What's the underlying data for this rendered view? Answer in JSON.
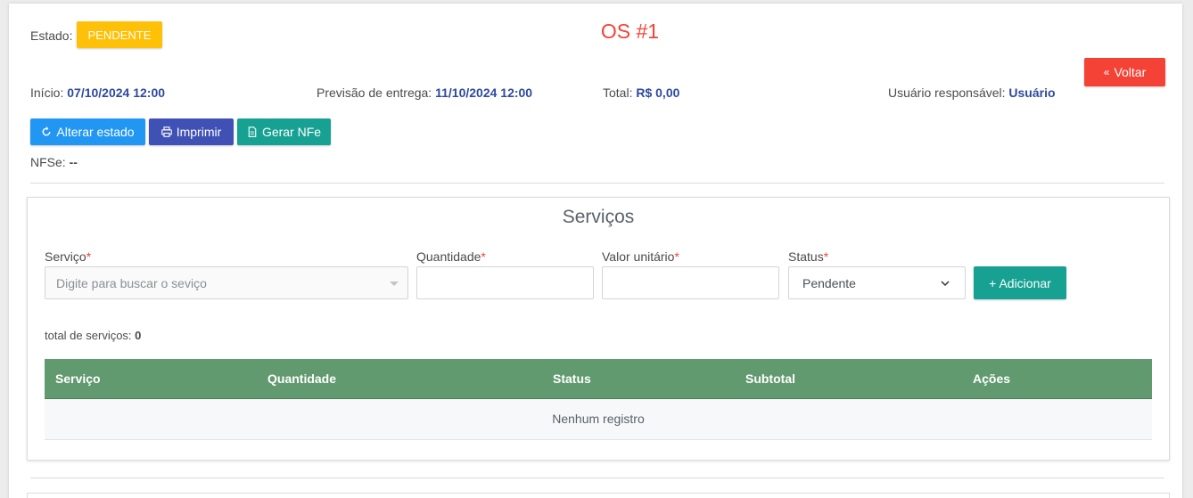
{
  "header": {
    "estado_label": "Estado:",
    "estado_badge": "PENDENTE",
    "title": "OS #1",
    "voltar_label": "Voltar",
    "inicio_label": "Início:",
    "inicio_value": "07/10/2024 12:00",
    "previsao_label": "Previsão de entrega:",
    "previsao_value": "11/10/2024 12:00",
    "total_label": "Total:",
    "total_value": "R$ 0,00",
    "usuario_label": "Usuário responsável:",
    "usuario_value": "Usuário",
    "nfse_label": "NFSe:",
    "nfse_value": "--"
  },
  "actions": {
    "alterar_estado": "Alterar estado",
    "imprimir": "Imprimir",
    "gerar_nfe": "Gerar NFe"
  },
  "servicos": {
    "title": "Serviços",
    "form": {
      "servico_label": "Serviço",
      "servico_placeholder": "Digite para buscar o seviço",
      "quantidade_label": "Quantidade",
      "quantidade_value": "",
      "valor_label": "Valor unitário",
      "valor_value": "",
      "status_label": "Status",
      "status_value": "Pendente",
      "required_mark": "*",
      "add_label": "+ Adicionar"
    },
    "total_label": "total de serviços:",
    "total_value": "0",
    "table": {
      "columns": [
        "Serviço",
        "Quantidade",
        "Status",
        "Subtotal",
        "Ações"
      ],
      "empty": "Nenhum registro"
    }
  },
  "colors": {
    "badge": "#ffc107",
    "title": "#f44336",
    "alterar": "#2196f3",
    "imprimir": "#3f51b5",
    "gerar": "#17a192",
    "table_header": "#629a6f"
  }
}
